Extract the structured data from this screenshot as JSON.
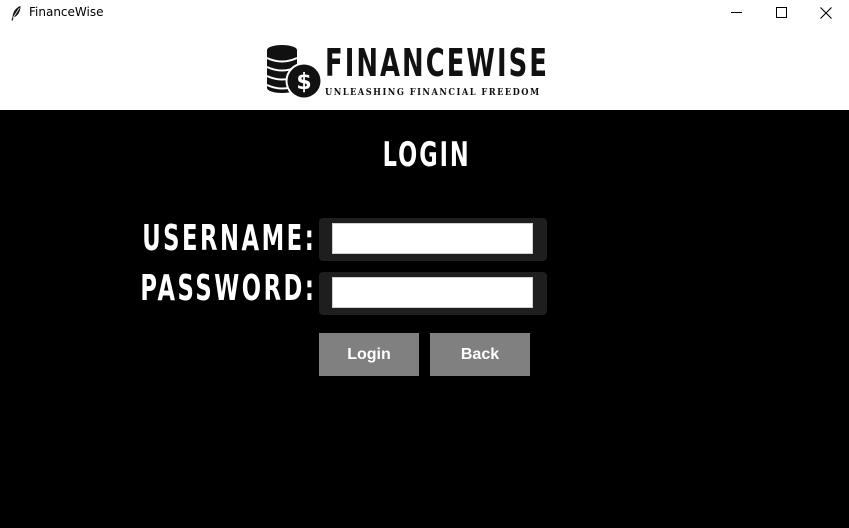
{
  "window": {
    "title": "FinanceWise",
    "icons": {
      "app": "feather-icon",
      "minimize": "minimize-icon",
      "maximize": "maximize-icon",
      "close": "close-icon"
    }
  },
  "header": {
    "logo_icon": "coin-stack-dollar-icon",
    "brand": "FINANCEWISE",
    "tagline": "UNLEASHING FINANCIAL FREEDOM"
  },
  "login": {
    "heading": "LOGIN",
    "username_label": "USERNAME:",
    "username_value": "",
    "password_label": "PASSWORD:",
    "password_value": "",
    "login_button": "Login",
    "back_button": "Back"
  },
  "colors": {
    "background": "#000000",
    "header_background": "#ffffff",
    "field_frame": "#1e1e1e",
    "button": "#808080",
    "text_light": "#ffffff",
    "text_dark": "#111111"
  }
}
